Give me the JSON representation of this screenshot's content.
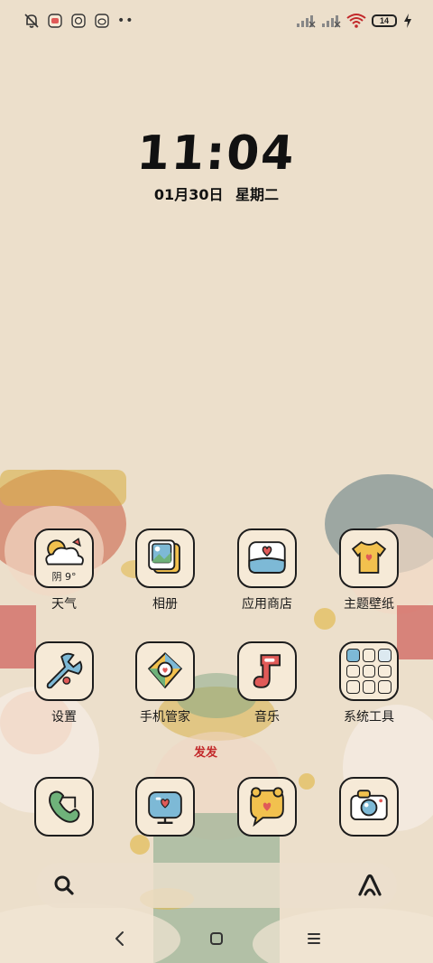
{
  "status_bar": {
    "left_icons": [
      "bell-muted-icon",
      "notification-app-icon-1",
      "notification-app-icon-2",
      "notification-app-icon-3"
    ],
    "more_dots": "••",
    "battery_level": "14",
    "right_icons": [
      "signal-bars-no-service-icon",
      "signal-bars-no-service-icon",
      "wifi-icon",
      "battery-icon",
      "charging-bolt-icon"
    ]
  },
  "clock": {
    "time": "11:04",
    "date": "01月30日",
    "weekday": "星期二"
  },
  "apps": [
    {
      "label": "天气",
      "icon": "weather-icon",
      "extra": "阴 9°"
    },
    {
      "label": "相册",
      "icon": "gallery-icon"
    },
    {
      "label": "应用商店",
      "icon": "app-store-icon"
    },
    {
      "label": "主题壁纸",
      "icon": "theme-wallpaper-icon"
    },
    {
      "label": "设置",
      "icon": "settings-icon"
    },
    {
      "label": "手机管家",
      "icon": "phone-manager-icon"
    },
    {
      "label": "音乐",
      "icon": "music-icon"
    },
    {
      "label": "系统工具",
      "icon": "system-tools-folder-icon"
    },
    {
      "label": "",
      "icon": "phone-icon"
    },
    {
      "label": "",
      "icon": "browser-icon"
    },
    {
      "label": "",
      "icon": "messages-icon"
    },
    {
      "label": "",
      "icon": "camera-icon"
    }
  ],
  "wallpaper_text": "发发",
  "dock": {
    "search_icon": "search-icon",
    "assistant_icon": "assistant-icon"
  },
  "nav_bar": {
    "back_icon": "back-icon",
    "home_icon": "home-icon",
    "recents_icon": "menu-icon"
  },
  "colors": {
    "background": "#ecdfcb",
    "icon_bg": "#f6ead7",
    "outline": "#1d1d1d",
    "accent_red": "#c2282a"
  }
}
